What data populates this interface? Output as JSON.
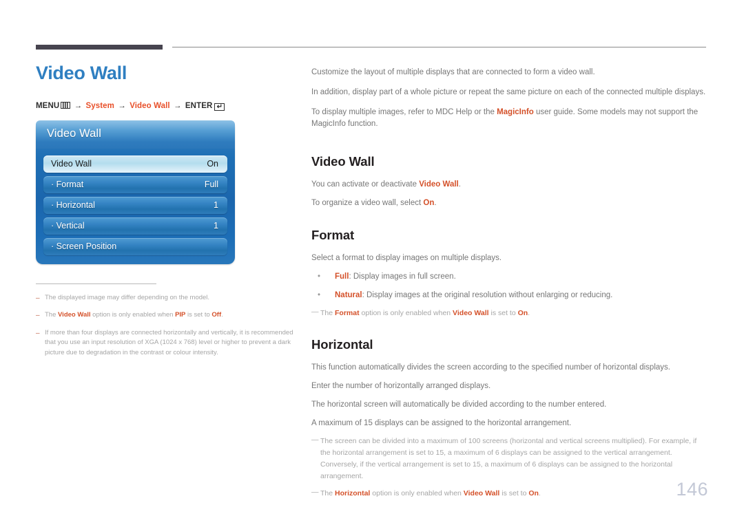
{
  "header": {
    "rule_left_color": "#47444f",
    "rule_right_color": "#8a8a8a"
  },
  "left": {
    "title": "Video Wall",
    "title_color": "#2f7fc1",
    "breadcrumb": {
      "menu_label": "MENU",
      "menu_icon": "menu-bars-icon",
      "arrow": "→",
      "step1": "System",
      "step2": "Video Wall",
      "enter_label": "ENTER",
      "enter_icon": "enter-key-icon",
      "accent_color": "#e8502a"
    },
    "osd": {
      "header_title": "Video Wall",
      "rows": [
        {
          "label": "Video Wall",
          "value": "On",
          "selected": true
        },
        {
          "label": "Format",
          "value": "Full",
          "selected": false
        },
        {
          "label": "Horizontal",
          "value": "1",
          "selected": false
        },
        {
          "label": "Vertical",
          "value": "1",
          "selected": false
        },
        {
          "label": "Screen Position",
          "value": "",
          "selected": false
        }
      ]
    },
    "notes": [
      {
        "dash": "–",
        "html": "The displayed image may differ depending on the model."
      },
      {
        "dash": "–",
        "html": "The <span class=\"accent-b\">Video Wall</span> option is only enabled when <span class=\"accent-b\">PIP</span> is set to <span class=\"accent-b\">Off</span>."
      },
      {
        "dash": "–",
        "html": "If more than four displays are connected horizontally and vertically, it is recommended that you use an input resolution of XGA (1024 x 768) level or higher to prevent a dark picture due to degradation in the contrast or colour intensity."
      }
    ]
  },
  "right": {
    "intro": [
      {
        "html": "Customize the layout of multiple displays that are connected to form a video wall."
      },
      {
        "html": "In addition, display part of a whole picture or repeat the same picture on each of the connected multiple displays."
      },
      {
        "html": "To display multiple images, refer to MDC Help or the <span class=\"accent-b\">MagicInfo</span> user guide. Some models may not support the MagicInfo function."
      }
    ],
    "sections": [
      {
        "heading": "Video Wall",
        "lines": [
          {
            "html": "You can activate or deactivate <span class=\"accent-b\">Video Wall</span>."
          },
          {
            "html": "To organize a video wall, select <span class=\"accent-b\">On</span>."
          }
        ],
        "bullets": [],
        "notes": []
      },
      {
        "heading": "Format",
        "lines": [
          {
            "html": "Select a format to display images on multiple displays."
          }
        ],
        "bullets": [
          {
            "dot": "•",
            "html": "<span class=\"accent-b\">Full</span>: Display images in full screen."
          },
          {
            "dot": "•",
            "html": "<span class=\"accent-b\">Natural</span>: Display images at the original resolution without enlarging or reducing."
          }
        ],
        "notes": [
          {
            "dash": "—",
            "html": "The <span class=\"accent-b\">Format</span> option is only enabled when <span class=\"accent-b\">Video Wall</span> is set to <span class=\"accent-b\">On</span>."
          }
        ]
      },
      {
        "heading": "Horizontal",
        "lines": [
          {
            "html": "This function automatically divides the screen according to the specified number of horizontal displays."
          },
          {
            "html": "Enter the number of horizontally arranged displays."
          },
          {
            "html": "The horizontal screen will automatically be divided according to the number entered."
          },
          {
            "html": "A maximum of 15 displays can be assigned to the horizontal arrangement."
          }
        ],
        "bullets": [],
        "notes": [
          {
            "dash": "—",
            "html": "The screen can be divided into a maximum of 100 screens (horizontal and vertical screens multiplied). For example, if the horizontal arrangement is set to 15, a maximum of 6 displays can be assigned to the vertical arrangement. Conversely, if the vertical arrangement is set to 15, a maximum of 6 displays can be assigned to the horizontal arrangement."
          },
          {
            "dash": "—",
            "html": "The <span class=\"accent-b\">Horizontal</span> option is only enabled when <span class=\"accent-b\">Video Wall</span> is set to <span class=\"accent-b\">On</span>."
          }
        ]
      }
    ]
  },
  "footer": {
    "page_number": "146",
    "page_number_color": "#c3c8d6"
  }
}
